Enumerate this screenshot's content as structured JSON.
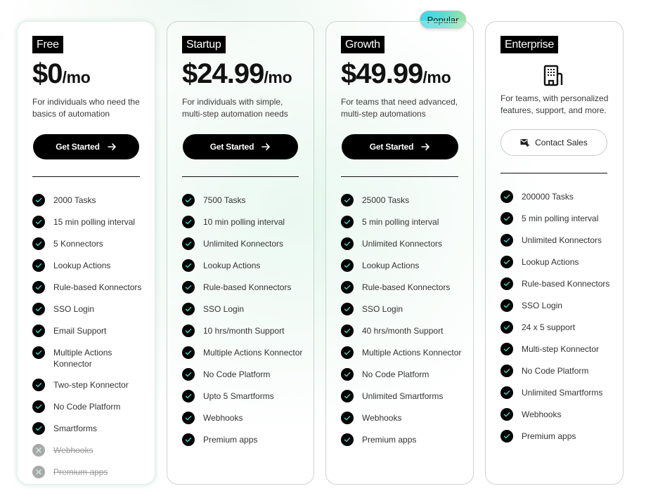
{
  "popular_badge": "Popular",
  "colors": {
    "accent_check": "#4fd1c5",
    "badge_gradient_start": "#3ed7ea",
    "badge_gradient_end": "#9ee3a4",
    "disabled_icon": "#a9a9a9"
  },
  "plans": [
    {
      "name": "Free",
      "price": "$0",
      "period": "/mo",
      "description": "For individuals who need the basics of automation",
      "cta_label": "Get Started",
      "cta_icon": "arrow-right-icon",
      "features": [
        {
          "label": "2000 Tasks",
          "included": true
        },
        {
          "label": "15 min polling interval",
          "included": true
        },
        {
          "label": "5 Konnectors",
          "included": true
        },
        {
          "label": "Lookup Actions",
          "included": true
        },
        {
          "label": "Rule-based Konnectors",
          "included": true
        },
        {
          "label": "SSO Login",
          "included": true
        },
        {
          "label": "Email Support",
          "included": true
        },
        {
          "label": "Multiple Actions Konnector",
          "included": true
        },
        {
          "label": "Two-step Konnector",
          "included": true
        },
        {
          "label": "No Code Platform",
          "included": true
        },
        {
          "label": "Smartforms",
          "included": true
        },
        {
          "label": "Webhooks",
          "included": false
        },
        {
          "label": "Premium apps",
          "included": false
        }
      ]
    },
    {
      "name": "Startup",
      "price": "$24.99",
      "period": "/mo",
      "description": "For individuals with simple, multi-step automation needs",
      "cta_label": "Get Started",
      "cta_icon": "arrow-right-icon",
      "features": [
        {
          "label": "7500 Tasks",
          "included": true
        },
        {
          "label": "10 min polling interval",
          "included": true
        },
        {
          "label": "Unlimited Konnectors",
          "included": true
        },
        {
          "label": "Lookup Actions",
          "included": true
        },
        {
          "label": "Rule-based Konnectors",
          "included": true
        },
        {
          "label": "SSO Login",
          "included": true
        },
        {
          "label": "10 hrs/month Support",
          "included": true
        },
        {
          "label": "Multiple Actions Konnector",
          "included": true
        },
        {
          "label": "No Code Platform",
          "included": true
        },
        {
          "label": "Upto 5 Smartforms",
          "included": true
        },
        {
          "label": "Webhooks",
          "included": true
        },
        {
          "label": "Premium apps",
          "included": true
        }
      ]
    },
    {
      "name": "Growth",
      "price": "$49.99",
      "period": "/mo",
      "description": "For teams that need advanced, multi-step automations",
      "cta_label": "Get Started",
      "cta_icon": "arrow-right-icon",
      "features": [
        {
          "label": "25000 Tasks",
          "included": true
        },
        {
          "label": "5 min polling interval",
          "included": true
        },
        {
          "label": "Unlimited Konnectors",
          "included": true
        },
        {
          "label": "Lookup Actions",
          "included": true
        },
        {
          "label": "Rule-based Konnectors",
          "included": true
        },
        {
          "label": "SSO Login",
          "included": true
        },
        {
          "label": "40 hrs/month Support",
          "included": true
        },
        {
          "label": "Multiple Actions Konnector",
          "included": true
        },
        {
          "label": "No Code Platform",
          "included": true
        },
        {
          "label": "Unlimited Smartforms",
          "included": true
        },
        {
          "label": "Webhooks",
          "included": true
        },
        {
          "label": "Premium apps",
          "included": true
        }
      ]
    },
    {
      "name": "Enterprise",
      "price_icon": "building-icon",
      "description": "For teams, with personalized features, support, and more.",
      "cta_label": "Contact Sales",
      "cta_icon": "mail-icon",
      "features": [
        {
          "label": "200000 Tasks",
          "included": true
        },
        {
          "label": "5 min polling interval",
          "included": true
        },
        {
          "label": "Unlimited Konnectors",
          "included": true
        },
        {
          "label": "Lookup Actions",
          "included": true
        },
        {
          "label": "Rule-based Konnectors",
          "included": true
        },
        {
          "label": "SSO Login",
          "included": true
        },
        {
          "label": "24 x 5 support",
          "included": true
        },
        {
          "label": "Multi-step Konnector",
          "included": true
        },
        {
          "label": "No Code Platform",
          "included": true
        },
        {
          "label": "Unlimited Smartforms",
          "included": true
        },
        {
          "label": "Webhooks",
          "included": true
        },
        {
          "label": "Premium apps",
          "included": true
        }
      ]
    }
  ]
}
